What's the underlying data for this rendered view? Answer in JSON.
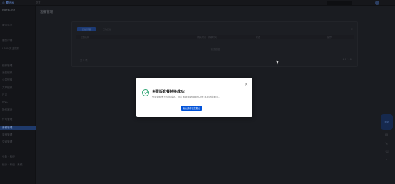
{
  "topbar": {
    "logo": "◎ 腾讯云",
    "logo_sub": "",
    "crumb": "总览",
    "notice": "",
    "nav": [
      "",
      "",
      "",
      "",
      "",
      "",
      "",
      ""
    ]
  },
  "sidebar": {
    "app_name": "ngetCine",
    "items": [
      {
        "label": "服务总览"
      },
      {
        "label": ""
      },
      {
        "label": "服务详情"
      },
      {
        "label": "HMG-安全规则"
      },
      {
        "label": ""
      },
      {
        "label": "镜像管理"
      },
      {
        "label": "我的镜像"
      },
      {
        "label": "公共镜像"
      },
      {
        "label": "共享镜像"
      },
      {
        "label": "日志"
      },
      {
        "label": "MVC"
      },
      {
        "label": "操作审计"
      },
      {
        "label": ""
      },
      {
        "label": "许可管理"
      },
      {
        "label": "套餐管理"
      },
      {
        "label": "实例管理"
      },
      {
        "label": "空间管理"
      },
      {
        "label": ""
      },
      {
        "label": "分析 · 系统"
      },
      {
        "label": "统计 · 系统 · 系统"
      }
    ],
    "active_index": 14
  },
  "main": {
    "page_title": "套餐管理",
    "tabs": [
      {
        "label": "套餐管理"
      },
      {
        "label": "已购套餐"
      },
      {
        "label": ""
      },
      {
        "label": ""
      }
    ],
    "columns": [
      "套餐名称",
      "",
      "购买时间 / 到期时间",
      "",
      "状态",
      "操作"
    ],
    "empty_text": "暂无数据",
    "footer_text": "共 0 项",
    "pager": "◂ 1 / 1 ▸"
  },
  "float": {
    "help_label": "帮助"
  },
  "modal": {
    "title": "免费版套餐兑换成功!",
    "description": "免费版套餐已兑换成功，可立即使用 WiggleCine 各项功能服务。",
    "button_label": "确认并前往控制台"
  }
}
